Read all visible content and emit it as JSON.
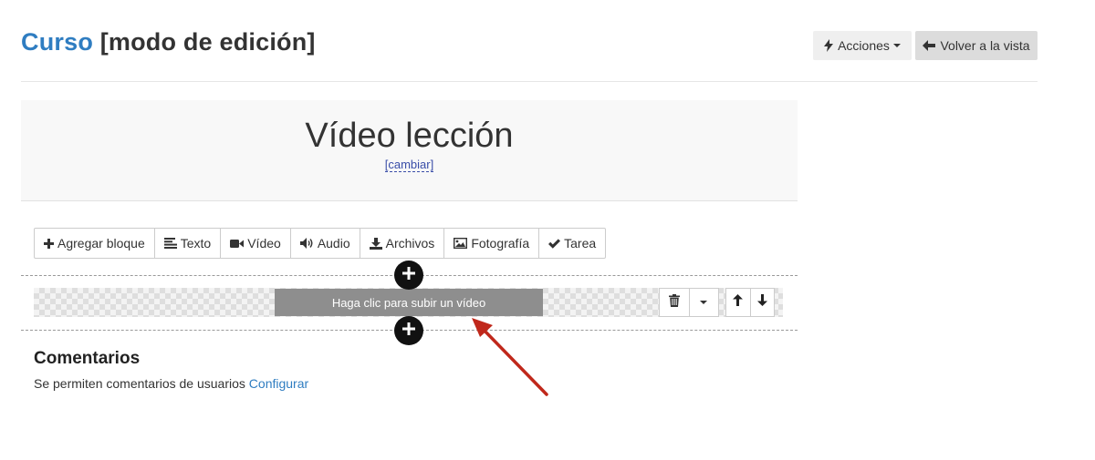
{
  "header": {
    "course_link": "Curso",
    "mode_label": "[modo de edición]",
    "actions_label": "Acciones",
    "back_label": "Volver a la vista"
  },
  "lesson": {
    "title": "Vídeo lección",
    "change_label": "[cambiar]"
  },
  "toolbar": {
    "items": [
      {
        "label": "Agregar bloque",
        "icon": "plus-icon"
      },
      {
        "label": "Texto",
        "icon": "align-left-icon"
      },
      {
        "label": "Vídeo",
        "icon": "video-camera-icon"
      },
      {
        "label": "Audio",
        "icon": "volume-icon"
      },
      {
        "label": "Archivos",
        "icon": "download-icon"
      },
      {
        "label": "Fotografía",
        "icon": "image-icon"
      },
      {
        "label": "Tarea",
        "icon": "check-icon"
      }
    ]
  },
  "video_block": {
    "upload_label": "Haga clic para subir un vídeo"
  },
  "comments": {
    "title": "Comentarios",
    "text": "Se permiten comentarios de usuarios",
    "configure_label": "Configurar"
  },
  "colors": {
    "link": "#2f7dc1",
    "upload_bar": "#8e8e8e",
    "annotation_arrow": "#c0281b"
  }
}
